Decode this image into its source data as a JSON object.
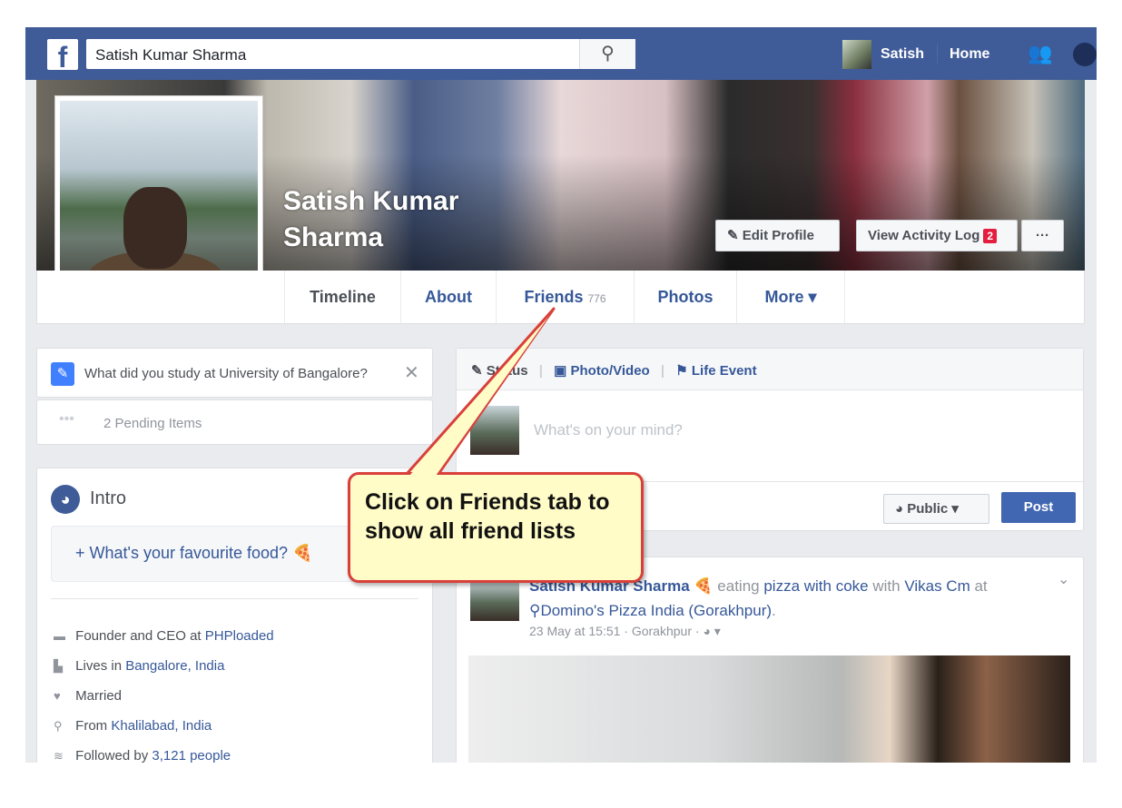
{
  "topbar": {
    "search_value": "Satish Kumar Sharma",
    "user": "Satish",
    "home": "Home"
  },
  "profile": {
    "name": "Satish Kumar Sharma",
    "edit_profile": "Edit Profile",
    "activity_log": "View Activity Log",
    "activity_count": "2",
    "more_dots": "···"
  },
  "tabs": [
    {
      "label": "Timeline"
    },
    {
      "label": "About"
    },
    {
      "label": "Friends",
      "count": "776"
    },
    {
      "label": "Photos"
    },
    {
      "label": "More ▾"
    }
  ],
  "prompt": {
    "question": "What did you study at University of Bangalore?",
    "pending": "2 Pending Items"
  },
  "intro": {
    "title": "Intro",
    "food_prompt": "What's your favourite food?",
    "items": [
      {
        "text": "Founder and CEO at ",
        "link": "PHPloaded"
      },
      {
        "text": "Lives in ",
        "link": "Bangalore, India"
      },
      {
        "text": "Married",
        "link": ""
      },
      {
        "text": "From ",
        "link": "Khalilabad, India"
      },
      {
        "text": "Followed by ",
        "link": "3,121 people"
      }
    ]
  },
  "composer": {
    "status": "Status",
    "photo": "Photo/Video",
    "life": "Life Event",
    "placeholder": "What's on your mind?",
    "privacy": "Public ▾",
    "post": "Post"
  },
  "post": {
    "author": "Satish Kumar Sharma",
    "activity": " eating ",
    "pizza": "pizza with coke",
    "with": " with ",
    "friend": "Vikas Cm",
    "at": " at",
    "place": "Domino's Pizza India (Gorakhpur)",
    "time": "23 May at 15:51 · Gorakhpur · "
  },
  "callout": {
    "text": "Click on Friends tab to show all friend lists"
  },
  "colors": {
    "brand": "#3f5b98",
    "link": "#365899",
    "callout_bg": "#fffcc8",
    "callout_border": "#d9403a",
    "post_button": "#4267b2"
  }
}
